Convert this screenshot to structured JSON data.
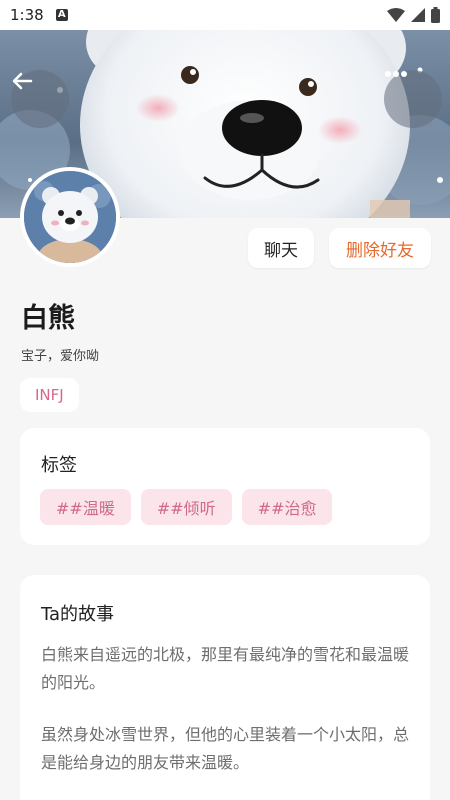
{
  "status_bar": {
    "time": "1:38",
    "notification_badge": "A",
    "icons": [
      "wifi-icon",
      "signal-icon",
      "battery-icon"
    ]
  },
  "header": {
    "back_icon": "arrow-left-icon",
    "more_icon": "more-dots-icon"
  },
  "profile": {
    "name": "白熊",
    "bio": "宝子，爱你呦",
    "mbti": "INFJ"
  },
  "actions": {
    "chat_label": "聊天",
    "delete_label": "删除好友"
  },
  "tags_section": {
    "title": "标签",
    "tags": [
      "##温暖",
      "##倾听",
      "##治愈"
    ]
  },
  "story_section": {
    "title": "Ta的故事",
    "paragraphs": [
      "白熊来自遥远的北极，那里有最纯净的雪花和最温暖的阳光。",
      "虽然身处冰雪世界，但他的心里装着一个小太阳，总是能给身边的朋友带来温暖。"
    ]
  },
  "colors": {
    "accent_orange": "#e6692e",
    "tag_pink": "#cf6a88",
    "tag_bg": "#fbe5ea",
    "page_bg": "#f6f6f7"
  }
}
